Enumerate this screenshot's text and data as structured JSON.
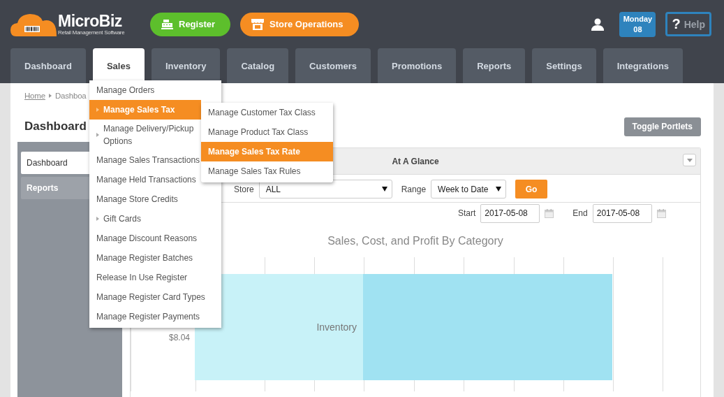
{
  "header": {
    "logo": {
      "name": "MicroBiz",
      "tagline": "Retail Management Software"
    },
    "buttons": [
      {
        "label": "Register",
        "kind": "register"
      },
      {
        "label": "Store Operations",
        "kind": "store"
      }
    ],
    "date": {
      "day": "Monday",
      "date": "08"
    },
    "help": {
      "icon": "?",
      "label": "Help"
    }
  },
  "tabs": [
    {
      "label": "Dashboard",
      "selected": false
    },
    {
      "label": "Sales",
      "selected": true
    },
    {
      "label": "Inventory",
      "selected": false
    },
    {
      "label": "Catalog",
      "selected": false
    },
    {
      "label": "Customers",
      "selected": false
    },
    {
      "label": "Promotions",
      "selected": false
    },
    {
      "label": "Reports",
      "selected": false
    },
    {
      "label": "Settings",
      "selected": false
    },
    {
      "label": "Integrations",
      "selected": false
    }
  ],
  "sales_menu": [
    {
      "label": "Manage Orders",
      "selected": false,
      "has_submenu": false
    },
    {
      "label": "Manage Sales Tax",
      "selected": true,
      "has_submenu": true
    },
    {
      "label": "Manage Delivery/Pickup Options",
      "selected": false,
      "has_submenu": true
    },
    {
      "label": "Manage Sales Transactions",
      "selected": false,
      "has_submenu": false
    },
    {
      "label": "Manage Held Transactions",
      "selected": false,
      "has_submenu": false
    },
    {
      "label": "Manage Store Credits",
      "selected": false,
      "has_submenu": false
    },
    {
      "label": "Gift Cards",
      "selected": false,
      "has_submenu": true
    },
    {
      "label": "Manage Discount Reasons",
      "selected": false,
      "has_submenu": false
    },
    {
      "label": "Manage Register Batches",
      "selected": false,
      "has_submenu": false
    },
    {
      "label": "Release In Use Register",
      "selected": false,
      "has_submenu": false
    },
    {
      "label": "Manage Register Card Types",
      "selected": false,
      "has_submenu": false
    },
    {
      "label": "Manage Register Payments",
      "selected": false,
      "has_submenu": false
    }
  ],
  "tax_submenu": [
    {
      "label": "Manage Customer Tax Class",
      "selected": false
    },
    {
      "label": "Manage Product Tax Class",
      "selected": false
    },
    {
      "label": "Manage Sales Tax Rate",
      "selected": true
    },
    {
      "label": "Manage Sales Tax Rules",
      "selected": false
    }
  ],
  "breadcrumb": [
    "Home",
    "Dashboa"
  ],
  "page_title": "Dashboard",
  "toggle_button": "Toggle Portlets",
  "sidebar": [
    {
      "label": "Dashboard",
      "selected": true
    },
    {
      "label": "Reports",
      "selected": false
    }
  ],
  "portlet": {
    "title": "At A Glance",
    "store": {
      "label": "Store",
      "value": "ALL"
    },
    "range": {
      "label": "Range",
      "value": "Week to Date"
    },
    "go": "Go",
    "start": {
      "label": "Start",
      "value": "2017-05-08"
    },
    "end": {
      "label": "End",
      "value": "2017-05-08"
    },
    "chart": {
      "title": "Sales, Cost, and Profit By Category",
      "value_label": "$8.04",
      "category": "Inventory"
    }
  }
}
